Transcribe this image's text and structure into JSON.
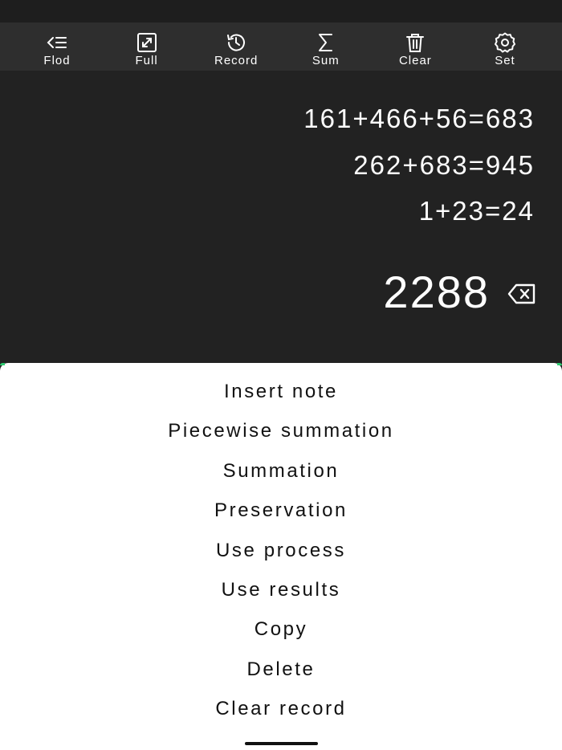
{
  "toolbar": {
    "items": [
      {
        "label": "Flod",
        "icon": "fold-menu-icon"
      },
      {
        "label": "Full",
        "icon": "fullscreen-icon"
      },
      {
        "label": "Record",
        "icon": "history-icon"
      },
      {
        "label": "Sum",
        "icon": "sigma-icon"
      },
      {
        "label": "Clear",
        "icon": "trash-icon"
      },
      {
        "label": "Set",
        "icon": "gear-icon"
      }
    ]
  },
  "display": {
    "history": [
      "161+466+56=683",
      "262+683=945",
      "1+23=24"
    ],
    "result": "2288",
    "backspace_icon": "backspace-icon"
  },
  "menu": {
    "items": [
      "Insert note",
      "Piecewise summation",
      "Summation",
      "Preservation",
      "Use process",
      "Use results",
      "Copy",
      "Delete",
      "Clear record"
    ]
  },
  "colors": {
    "toolbar_bg": "#2e2e2e",
    "display_bg": "#222222",
    "sheet_bg": "#ffffff",
    "accent": "#2ecc71"
  }
}
